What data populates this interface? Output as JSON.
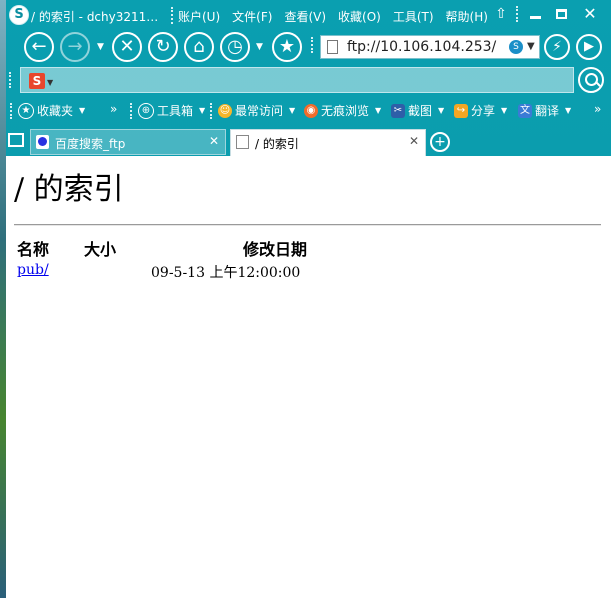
{
  "window": {
    "title": "/ 的索引 - dchy3211…",
    "menu": [
      "账户(U)",
      "文件(F)",
      "查看(V)",
      "收藏(O)",
      "工具(T)",
      "帮助(H)"
    ],
    "app_logo": "S"
  },
  "toolbar": {
    "back_icon": "←",
    "forward_icon": "→",
    "stop_icon": "✕",
    "refresh_icon": "↻",
    "home_icon": "⌂",
    "history_icon": "◷",
    "favorite_icon": "★",
    "go_icon": "▶",
    "flash_icon": "⚡"
  },
  "address_bar": {
    "url": "ftp://10.106.104.253/"
  },
  "search": {
    "logo": "S"
  },
  "favorites_bar": {
    "favorites": "收藏夹",
    "toolbox": "工具箱",
    "most_visited": "最常访问",
    "incognito": "无痕浏览",
    "screenshot": "截图",
    "share": "分享",
    "translate": "翻译",
    "more": "»"
  },
  "tabs": [
    {
      "label": "百度搜索_ftp",
      "active": false
    },
    {
      "label": "/ 的索引",
      "active": true
    }
  ],
  "page": {
    "heading": "/ 的索引",
    "columns": {
      "name": "名称",
      "size": "大小",
      "modified": "修改日期"
    },
    "rows": [
      {
        "name": "pub/",
        "size": "",
        "modified": "09-5-13 上午12:00:00"
      }
    ]
  },
  "colors": {
    "chrome": "#0a9fb0",
    "link": "#0000ee"
  }
}
